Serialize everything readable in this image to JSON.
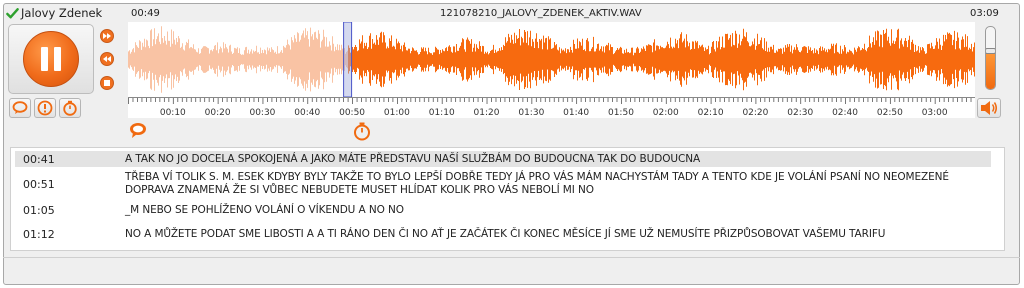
{
  "caller": {
    "name": "Jalovy Zdenek",
    "icon": "check-icon"
  },
  "player": {
    "current_time": "00:49",
    "file_name": "121078210_JALOVY_ZDENEK_AKTIV.WAV",
    "duration": "03:09",
    "playhead_seconds": 49,
    "duration_seconds": 189,
    "state": "pause-icon",
    "volume_level": 0.62,
    "colors": {
      "accent": "#f06a10",
      "played": "#f9c3a4",
      "unplayed": "#f76a0f",
      "playhead": "#4a55c8"
    }
  },
  "ruler_labels": [
    "00:10",
    "00:20",
    "00:30",
    "00:40",
    "00:50",
    "01:00",
    "01:10",
    "01:20",
    "01:30",
    "01:40",
    "01:50",
    "02:00",
    "02:10",
    "02:20",
    "02:30",
    "02:40",
    "02:50",
    "03:00"
  ],
  "side_controls": [
    "fast-forward-icon",
    "rewind-icon",
    "stop-icon"
  ],
  "tool_buttons": [
    "comment-icon",
    "warning-icon",
    "stopwatch-icon"
  ],
  "markers": [
    {
      "icon": "comment-icon",
      "seconds": 0
    },
    {
      "icon": "stopwatch-icon",
      "seconds": 50
    }
  ],
  "transcript": [
    {
      "time": "00:41",
      "text": "A TAK NO JO DOCELA SPOKOJENÁ A JAKO MÁTE PŘEDSTAVU NAŠÍ SLUŽBÁM DO BUDOUCNA TAK DO BUDOUCNA",
      "active": true
    },
    {
      "time": "00:51",
      "text": "TŘEBA VÍ TOLIK S. M. ESEK KDYBY BYLY TAKŽE TO BYLO LEPŠÍ DOBŘE TEDY JÁ PRO VÁS MÁM NACHYSTÁM TADY A TENTO KDE JE VOLÁNÍ PSANÍ NO NEOMEZENÉ DOPRAVA ZNAMENÁ ŽE SI VŮBEC NEBUDETE MUSET HLÍDAT KOLIK PRO VÁS NEBOLÍ MI NO",
      "active": false
    },
    {
      "time": "01:05",
      "text": "_M NEBO SE POHLÍŽENO VOLÁNÍ O VÍKENDU A NO NO",
      "active": false
    },
    {
      "time": "01:12",
      "text": "NO A MŮŽETE PODAT SME LIBOSTI A A TI RÁNO DEN ČI NO AŤ JE ZAČÁTEK ČI KONEC MĚSÍCE JÍ SME UŽ NEMUSÍTE PŘIZPŮSOBOVAT VAŠEMU TARIFU",
      "active": false
    }
  ]
}
